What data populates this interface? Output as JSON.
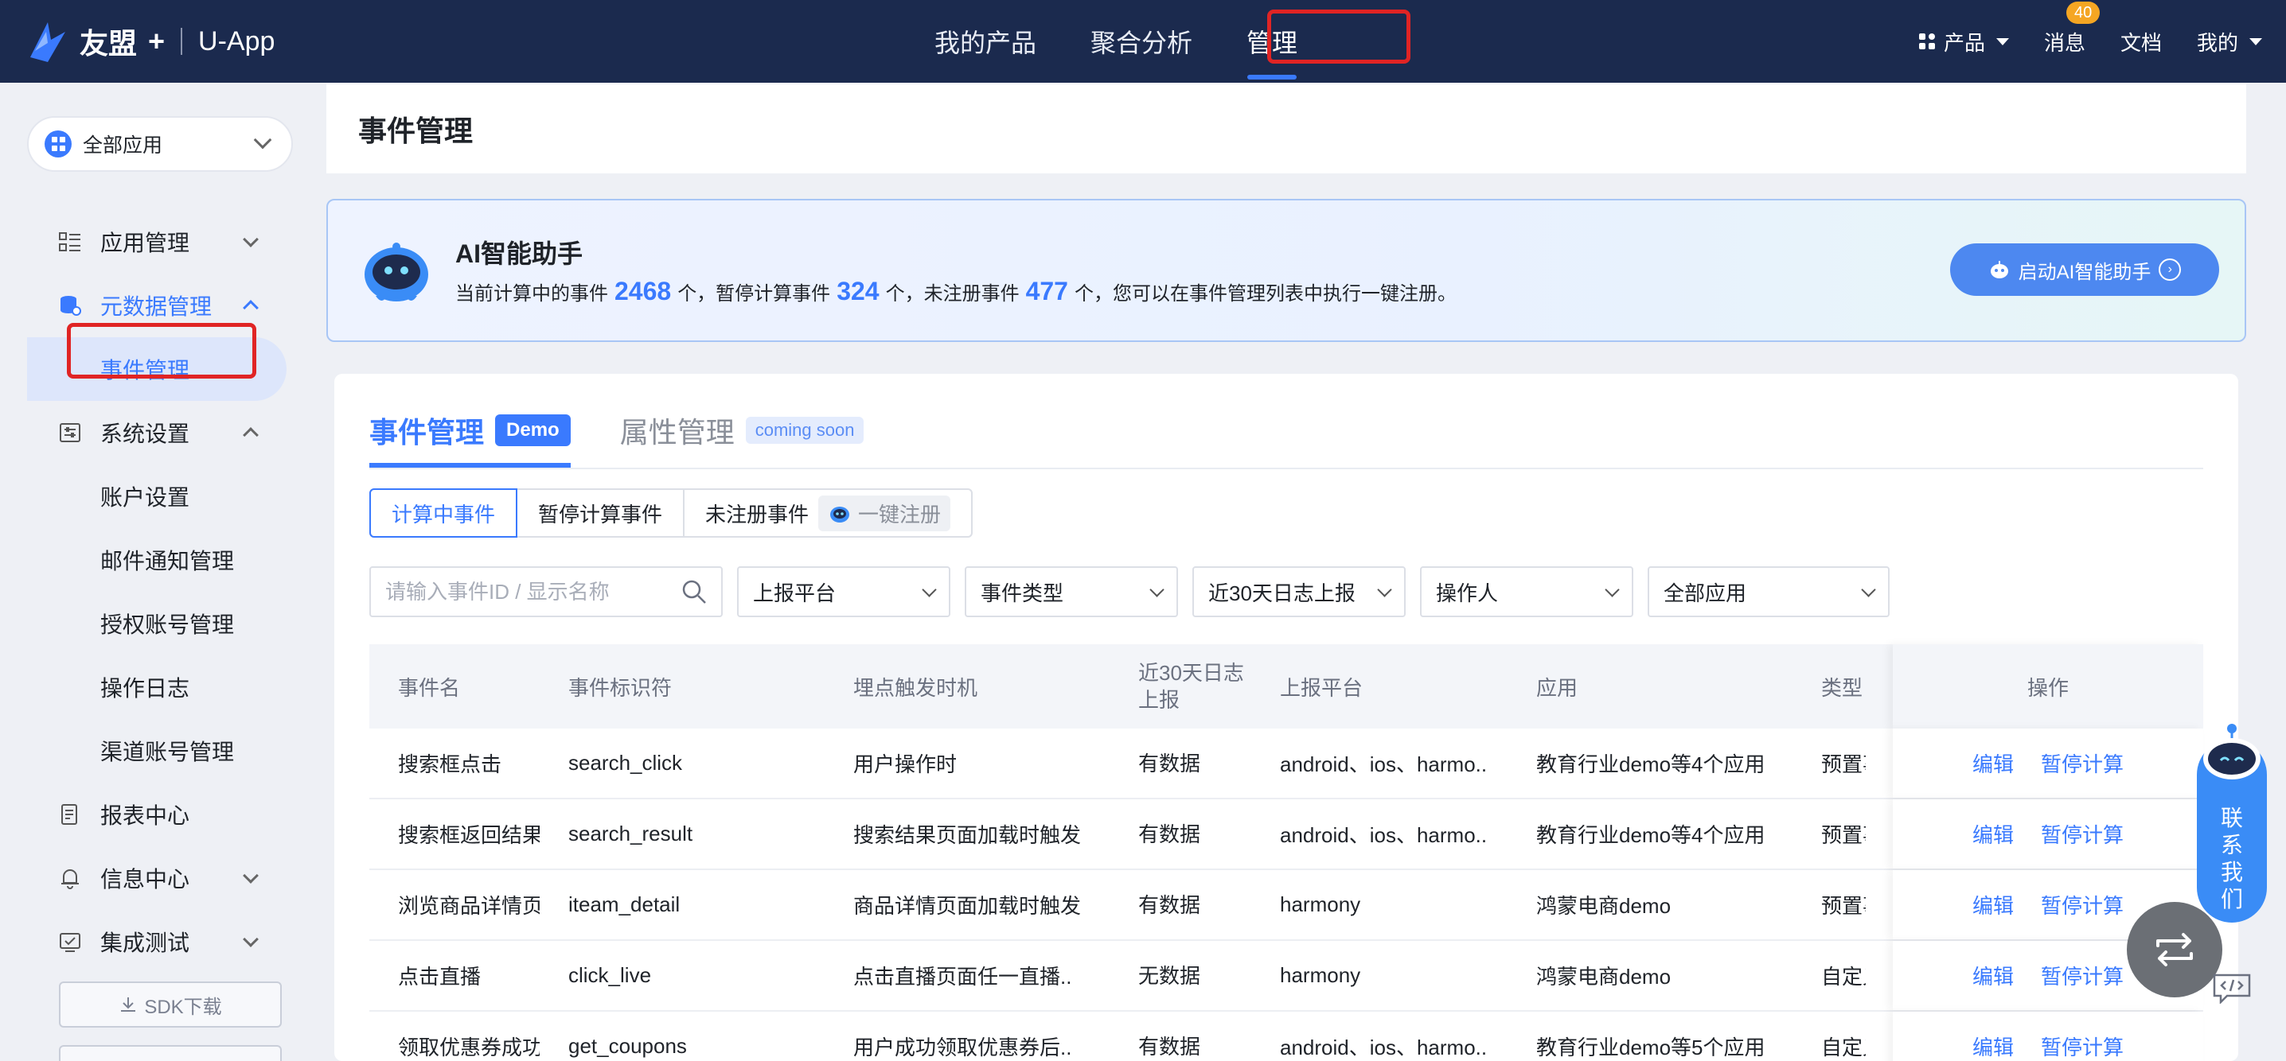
{
  "topbar": {
    "brand": "友盟",
    "brand_plus": "+",
    "app": "U-App",
    "nav": [
      "我的产品",
      "聚合分析",
      "管理"
    ],
    "right": {
      "product": "产品",
      "messages": "消息",
      "message_count": "40",
      "docs": "文档",
      "mine": "我的"
    }
  },
  "sidebar": {
    "app_select": "全部应用",
    "items": [
      {
        "label": "应用管理"
      },
      {
        "label": "元数据管理"
      },
      {
        "label": "事件管理"
      },
      {
        "label": "系统设置"
      },
      {
        "label": "账户设置"
      },
      {
        "label": "邮件通知管理"
      },
      {
        "label": "授权账号管理"
      },
      {
        "label": "操作日志"
      },
      {
        "label": "渠道账号管理"
      },
      {
        "label": "报表中心"
      },
      {
        "label": "信息中心"
      },
      {
        "label": "集成测试"
      }
    ],
    "sdk": "SDK下载"
  },
  "page": {
    "title": "事件管理"
  },
  "ai": {
    "title": "AI智能助手",
    "p1": "当前计算中的事件",
    "n1": "2468",
    "p2": "个，暂停计算事件",
    "n2": "324",
    "p3": "个，未注册事件",
    "n3": "477",
    "p4": "个，您可以在事件管理列表中执行一键注册。",
    "button": "启动AI智能助手"
  },
  "tabs": {
    "event": "事件管理",
    "demo": "Demo",
    "attr": "属性管理",
    "soon": "coming soon"
  },
  "segments": {
    "computing": "计算中事件",
    "paused": "暂停计算事件",
    "unregistered": "未注册事件",
    "one_click": "一键注册"
  },
  "filters": {
    "search_placeholder": "请输入事件ID / 显示名称",
    "platform": "上报平台",
    "type": "事件类型",
    "log": "近30天日志上报",
    "operator": "操作人",
    "app": "全部应用"
  },
  "table": {
    "headers": [
      "事件名",
      "事件标识符",
      "埋点触发时机",
      "近30天日志上报",
      "上报平台",
      "应用",
      "类型",
      "操作"
    ],
    "actions": {
      "edit": "编辑",
      "pause": "暂停计算"
    },
    "rows": [
      [
        "搜索框点击",
        "search_click",
        "用户操作时",
        "有数据",
        "android、ios、harmo..",
        "教育行业demo等4个应用",
        "预置事件"
      ],
      [
        "搜索框返回结果",
        "search_result",
        "搜索结果页面加载时触发",
        "有数据",
        "android、ios、harmo..",
        "教育行业demo等4个应用",
        "预置事件"
      ],
      [
        "浏览商品详情页",
        "iteam_detail",
        "商品详情页面加载时触发",
        "有数据",
        "harmony",
        "鸿蒙电商demo",
        "预置事件"
      ],
      [
        "点击直播",
        "click_live",
        "点击直播页面任一直播..",
        "无数据",
        "harmony",
        "鸿蒙电商demo",
        "自定义事件"
      ],
      [
        "领取优惠券成功",
        "get_coupons",
        "用户成功领取优惠券后..",
        "有数据",
        "android、ios、harmo..",
        "教育行业demo等5个应用",
        "自定义事件"
      ]
    ]
  },
  "floating": {
    "contact": [
      "联",
      "系",
      "我",
      "们"
    ]
  },
  "colors": {
    "nav_bg": "#1b2a4e",
    "accent": "#3a7afe",
    "highlight": "#e02424"
  }
}
